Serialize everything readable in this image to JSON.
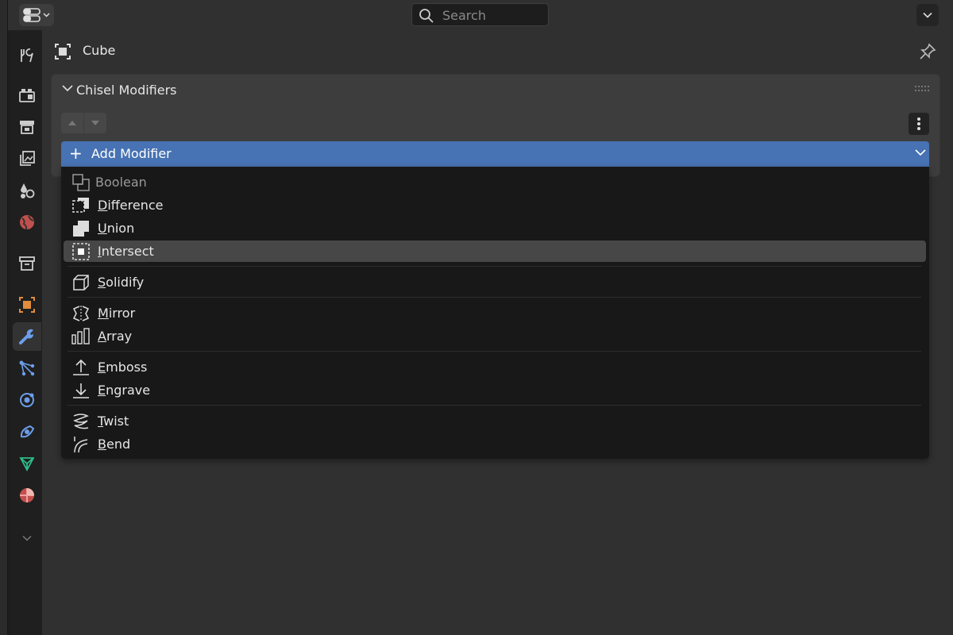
{
  "topbar": {
    "search_placeholder": "Search"
  },
  "object": {
    "name": "Cube"
  },
  "panel": {
    "title": "Chisel Modifiers",
    "add_button_label": "Add Modifier"
  },
  "menu": {
    "header": "Boolean",
    "items": [
      {
        "label": "Difference",
        "icon": "boolean-difference-icon"
      },
      {
        "label": "Union",
        "icon": "boolean-union-icon"
      },
      {
        "label": "Intersect",
        "icon": "boolean-intersect-icon",
        "highlighted": true
      },
      {
        "label": "Solidify",
        "icon": "solidify-icon"
      },
      {
        "label": "Mirror",
        "icon": "mirror-icon"
      },
      {
        "label": "Array",
        "icon": "array-icon"
      },
      {
        "label": "Emboss",
        "icon": "emboss-icon"
      },
      {
        "label": "Engrave",
        "icon": "engrave-icon"
      },
      {
        "label": "Twist",
        "icon": "twist-icon"
      },
      {
        "label": "Bend",
        "icon": "bend-icon"
      }
    ]
  },
  "colors": {
    "accent": "#4772b3",
    "menu_bg": "#181818",
    "highlight": "#474747",
    "modifier_tab": "#6d9eeb",
    "object_tab": "#e08d3c"
  }
}
